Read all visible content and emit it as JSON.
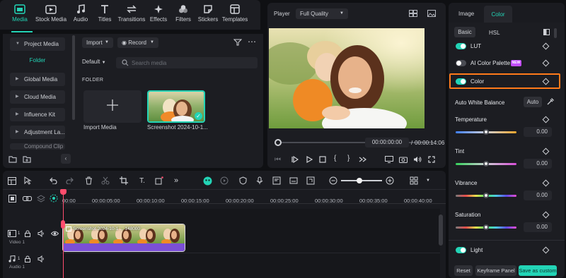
{
  "toolbar": {
    "tabs": [
      {
        "label": "Media",
        "icon": "media-icon",
        "active": true
      },
      {
        "label": "Stock Media",
        "icon": "stock-media-icon"
      },
      {
        "label": "Audio",
        "icon": "music-note-icon"
      },
      {
        "label": "Titles",
        "icon": "titles-icon"
      },
      {
        "label": "Transitions",
        "icon": "transitions-icon"
      },
      {
        "label": "Effects",
        "icon": "effects-icon"
      },
      {
        "label": "Filters",
        "icon": "filters-icon"
      },
      {
        "label": "Stickers",
        "icon": "stickers-icon"
      },
      {
        "label": "Templates",
        "icon": "templates-icon"
      }
    ]
  },
  "media": {
    "sidebar": {
      "project_media": "Project Media",
      "folder": "Folder",
      "items": [
        "Global Media",
        "Cloud Media",
        "Influence Kit",
        "Adjustment La...",
        "Compound Clip"
      ]
    },
    "import_label": "Import",
    "record_label": "Record",
    "sort_label": "Default",
    "search_placeholder": "Search media",
    "folder_heading": "FOLDER",
    "import_media_label": "Import Media",
    "clip_label": "Screenshot 2024-10-1..."
  },
  "player": {
    "label": "Player",
    "quality": "Full Quality",
    "current_time": "00:00:00:00",
    "separator": "/",
    "total_time": "00:00:14:06"
  },
  "right_panel": {
    "tabs": [
      "Image",
      "Color"
    ],
    "active_tab": "Color",
    "subtabs": [
      "Basic",
      "HSL"
    ],
    "lut_label": "LUT",
    "ai_palette_label": "AI Color Palette",
    "new_badge": "NEW",
    "color_label": "Color",
    "auto_wb_label": "Auto White Balance",
    "auto_button": "Auto",
    "sliders": [
      {
        "label": "Temperature",
        "value": "0.00"
      },
      {
        "label": "Tint",
        "value": "0.00"
      },
      {
        "label": "Vibrance",
        "value": "0.00"
      },
      {
        "label": "Saturation",
        "value": "0.00"
      }
    ],
    "light_label": "Light",
    "reset_button": "Reset",
    "keyframe_button": "Keyframe Panel",
    "save_custom_button": "Save as custom"
  },
  "timeline": {
    "ruler": [
      "00:00",
      "00:00:05:00",
      "00:00:10:00",
      "00:00:15:00",
      "00:00:20:00",
      "00:00:25:00",
      "00:00:30:00",
      "00:00:35:00",
      "00:00:40:00"
    ],
    "video_track_label": "Video 1",
    "video_track_number": "1",
    "audio_track_label": "Audio 1",
    "audio_track_number": "1",
    "clip_title": "Screenshot 2024-10-1 ... 148000"
  },
  "colors": {
    "accent": "#23d4b6",
    "highlight_border": "#ff7a1a",
    "clip_purple": "#7b4fd6",
    "playhead": "#ff4d6d",
    "new_badge": "#c34dff"
  }
}
